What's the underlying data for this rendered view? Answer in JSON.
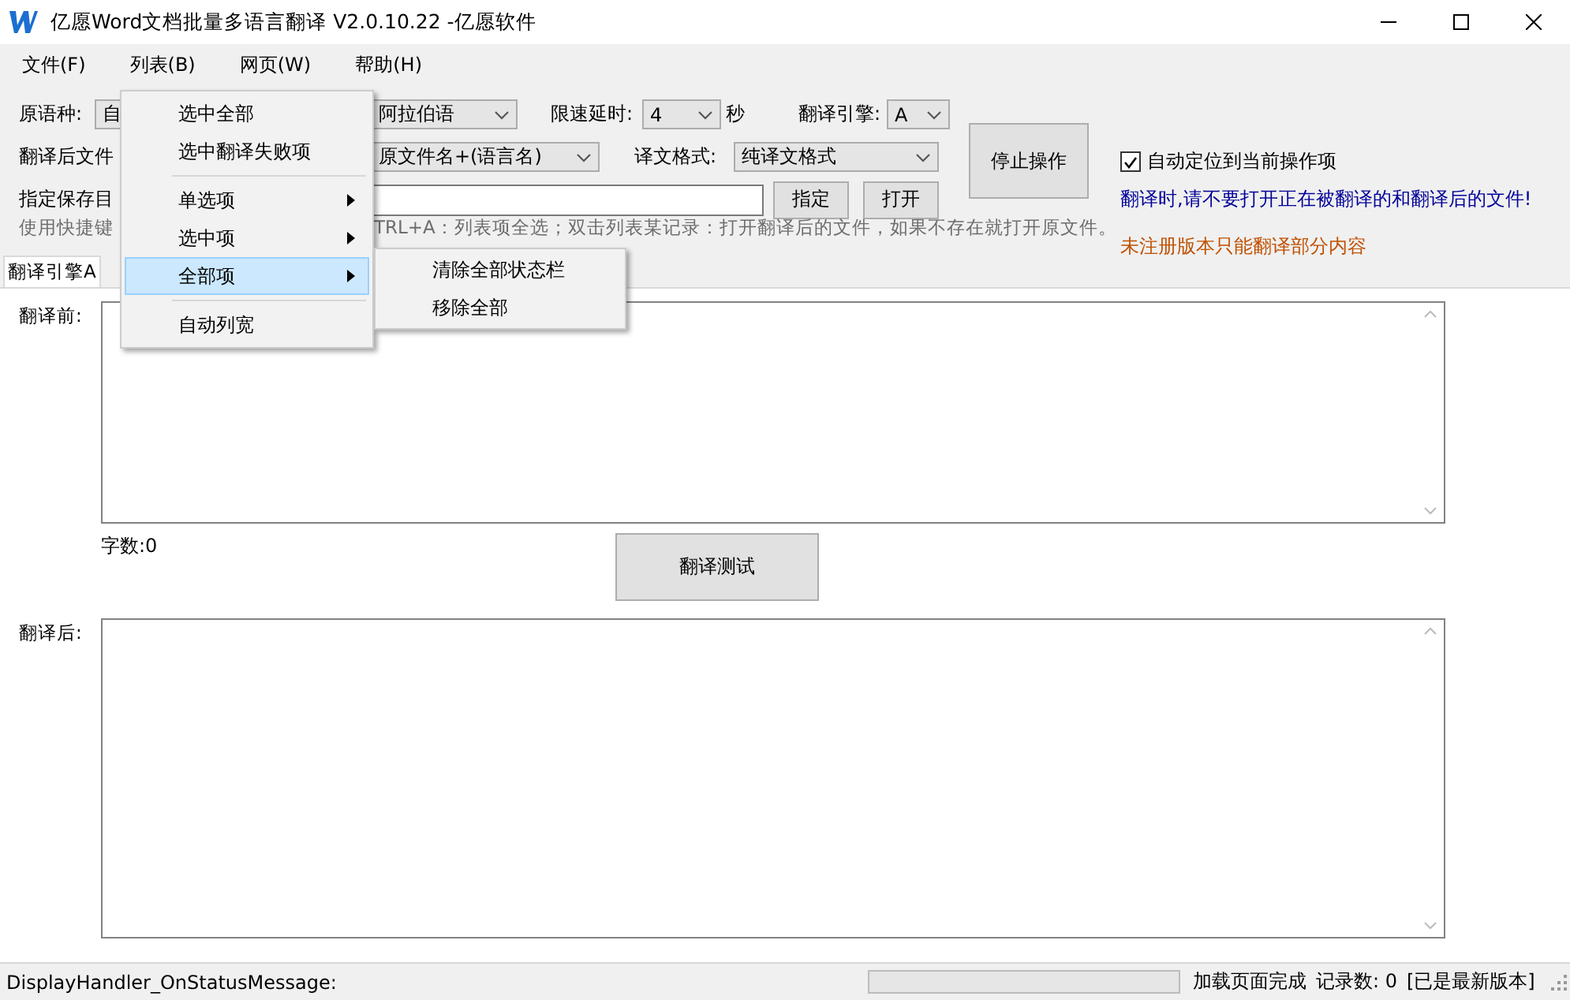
{
  "window": {
    "title": "亿愿Word文档批量多语言翻译 V2.0.10.22 -亿愿软件"
  },
  "menu_bar": [
    {
      "label": "文件(F)"
    },
    {
      "label": "列表(B)"
    },
    {
      "label": "网页(W)"
    },
    {
      "label": "帮助(H)"
    }
  ],
  "open_menu": {
    "items": [
      {
        "kind": "item",
        "label": "选中全部",
        "submenu": false,
        "selected": false
      },
      {
        "kind": "item",
        "label": "选中翻译失败项",
        "submenu": false,
        "selected": false
      },
      {
        "kind": "separator"
      },
      {
        "kind": "item",
        "label": "单选项",
        "submenu": true,
        "selected": false
      },
      {
        "kind": "item",
        "label": "选中项",
        "submenu": true,
        "selected": false
      },
      {
        "kind": "item",
        "label": "全部项",
        "submenu": true,
        "selected": true
      },
      {
        "kind": "separator"
      },
      {
        "kind": "item",
        "label": "自动列宽",
        "submenu": false,
        "selected": false
      }
    ],
    "submenu": [
      {
        "label": "清除全部状态栏"
      },
      {
        "label": "移除全部"
      }
    ]
  },
  "form": {
    "source_language": {
      "label": "原语种:",
      "value": "自"
    },
    "target_language": {
      "value": "阿拉伯语"
    },
    "delay": {
      "label": "限速延时:",
      "value": "4",
      "unit": "秒"
    },
    "engine": {
      "label": "翻译引擎:",
      "value": "A"
    },
    "output_file_label": "翻译后文件",
    "output_name": {
      "value": "原文件名+(语言名)"
    },
    "output_format": {
      "label": "译文格式:",
      "value": "纯译文格式"
    },
    "save_dir_label": "指定保存目",
    "buttons": [
      "指定",
      "打开"
    ],
    "hint_left": "使用快捷键",
    "hint_right": "TRL+A：列表项全选；双击列表某记录：打开翻译后的文件，如果不存在就打开原文件。",
    "stop_button": "停止操作",
    "auto_locate": {
      "label": "自动定位到当前操作项",
      "checked": true
    },
    "warning": "翻译时,请不要打开正在被翻译的和翻译后的文件!",
    "unregistered_note": "未注册版本只能翻译部分内容"
  },
  "tabs": [
    {
      "label": "翻译引擎A",
      "selected": true
    }
  ],
  "translation": {
    "before_label": "翻译前:",
    "char_count": "字数:0",
    "test_button": "翻译测试",
    "after_label": "翻译后:"
  },
  "status_bar": {
    "message": "DisplayHandler_OnStatusMessage:",
    "progress": {
      "level": 0
    },
    "load_status": "加载页面完成",
    "record_count": "记录数: 0",
    "version_status": "[已是最新版本]"
  }
}
